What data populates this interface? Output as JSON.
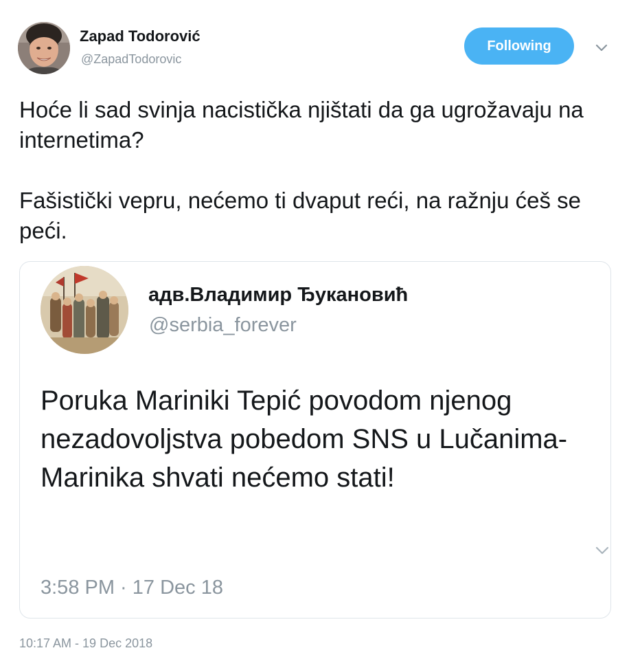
{
  "tweet": {
    "author": {
      "name": "Zapad Todorović",
      "handle": "@ZapadTodorovic"
    },
    "follow_button_label": "Following",
    "paragraphs": [
      "Hoće li sad svinja nacistička njištati da ga ugrožavaju na internetima?",
      "Fašistički vepru, nećemo ti dvaput reći, na ražnju ćeš se peći."
    ],
    "timestamp": "10:17 AM - 19 Dec 2018"
  },
  "quoted_tweet": {
    "author": {
      "name": "адв.Владимир Ђукановић",
      "handle": "@serbia_forever"
    },
    "text": "Poruka Mariniki Tepić povodom njenog nezadovoljstva pobedom SNS u Lučanima- Marinika shvati nećemo stati!",
    "timestamp": "3:58 PM · 17 Dec 18"
  },
  "icons": {
    "main_menu": "chevron-down-icon",
    "quote_menu": "chevron-down-icon"
  },
  "colors": {
    "accent": "#4ab3f4",
    "text": "#14171a",
    "muted": "#8a959e",
    "border": "#dfe5ea"
  }
}
